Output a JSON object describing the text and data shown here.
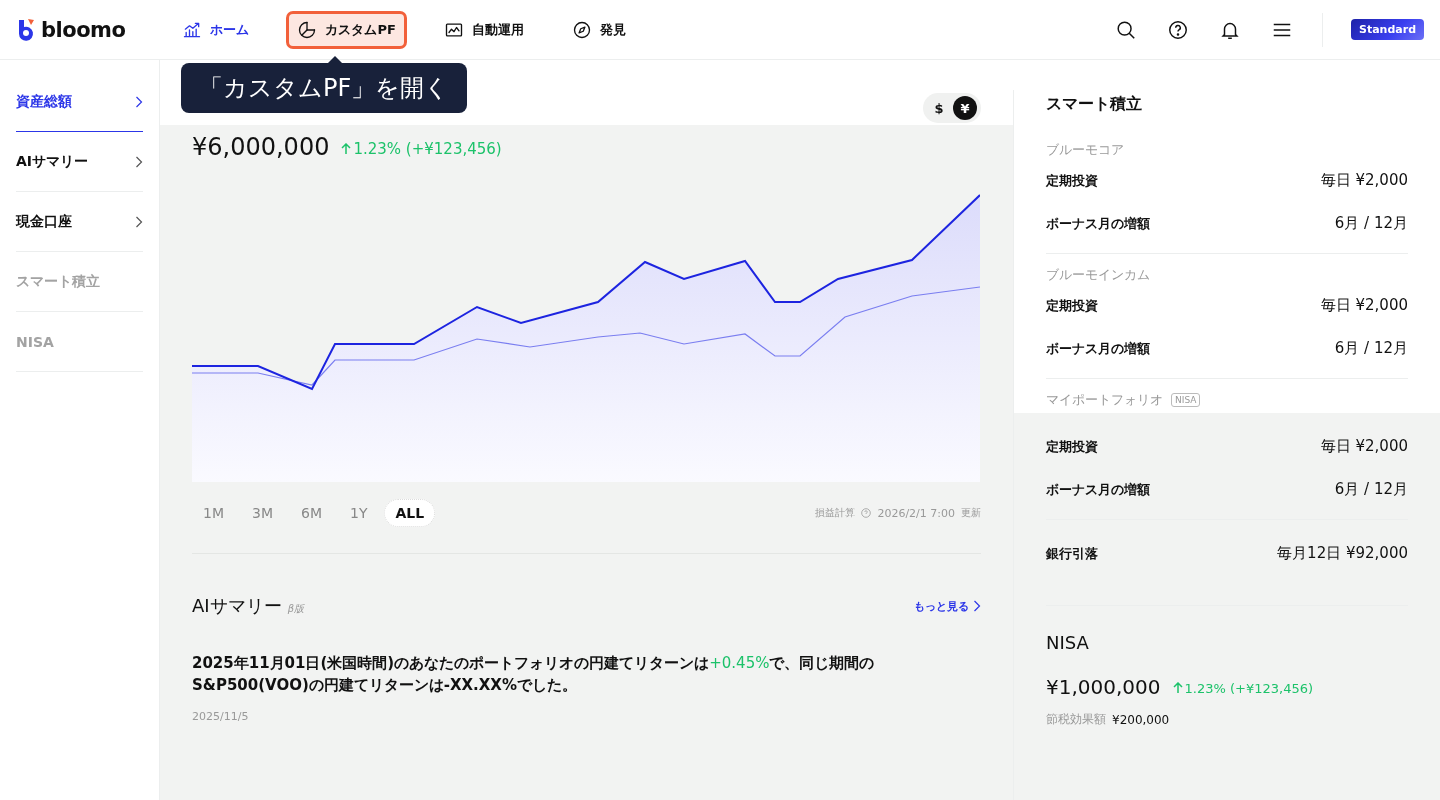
{
  "header": {
    "logo": "bloomo",
    "nav": [
      {
        "label": "ホーム",
        "selected": true,
        "highlighted": false
      },
      {
        "label": "カスタムPF",
        "selected": false,
        "highlighted": true
      },
      {
        "label": "自動運用",
        "selected": false,
        "highlighted": false
      },
      {
        "label": "発見",
        "selected": false,
        "highlighted": false
      }
    ],
    "plan_badge": "Standard"
  },
  "tooltip": "「カスタムPF」を開く",
  "sidebar": {
    "items": [
      {
        "label": "資産総額",
        "selected": true,
        "disabled": false
      },
      {
        "label": "AIサマリー",
        "selected": false,
        "disabled": false
      },
      {
        "label": "現金口座",
        "selected": false,
        "disabled": false
      },
      {
        "label": "スマート積立",
        "selected": false,
        "disabled": true
      },
      {
        "label": "NISA",
        "selected": false,
        "disabled": true
      }
    ]
  },
  "assets": {
    "currencies": [
      {
        "label": "$",
        "selected": false
      },
      {
        "label": "¥",
        "selected": true
      }
    ],
    "total": "¥6,000,000",
    "change": "1.23% (+¥123,456)",
    "ranges": [
      {
        "label": "1M",
        "selected": false
      },
      {
        "label": "3M",
        "selected": false
      },
      {
        "label": "6M",
        "selected": false
      },
      {
        "label": "1Y",
        "selected": false
      },
      {
        "label": "ALL",
        "selected": true
      }
    ],
    "calc_label": "損益計算",
    "updated": "2026/2/1 7:00",
    "updated_suffix": "更新"
  },
  "ai_summary": {
    "title": "AIサマリー",
    "beta": "β版",
    "more": "もっと見る",
    "parts": [
      {
        "kind": "plain",
        "text": "2025年11月01日(米国時間)のあなたのポートフォリオの円建てリターンは"
      },
      {
        "kind": "positive",
        "text": "+0.45%"
      },
      {
        "kind": "plain",
        "text": "で、同じ期間のS&P500(VOO)の円建てリターンは-XX.XX%でした。"
      }
    ],
    "date": "2025/11/5"
  },
  "smart": {
    "title": "スマート積立",
    "groups": [
      {
        "name": "ブルーモコア",
        "rows": [
          {
            "label": "定期投資",
            "value": "毎日 ¥2,000"
          },
          {
            "label": "ボーナス月の増額",
            "value": "6月 / 12月"
          }
        ]
      },
      {
        "name": "ブルーモインカム",
        "rows": [
          {
            "label": "定期投資",
            "value": "毎日 ¥2,000"
          },
          {
            "label": "ボーナス月の増額",
            "value": "6月 / 12月"
          }
        ]
      },
      {
        "name": "マイポートフォリオ",
        "badge": "NISA",
        "rows": [
          {
            "label": "定期投資",
            "value": "毎日 ¥2,000"
          },
          {
            "label": "ボーナス月の増額",
            "value": "6月 / 12月"
          }
        ]
      }
    ],
    "bank": {
      "label": "銀行引落",
      "value": "毎月12日 ¥92,000"
    }
  },
  "nisa": {
    "title": "NISA",
    "total": "¥1,000,000",
    "change": "1.23% (+¥123,456)",
    "tax_label": "節税効果額",
    "tax_value": "¥200,000"
  }
}
